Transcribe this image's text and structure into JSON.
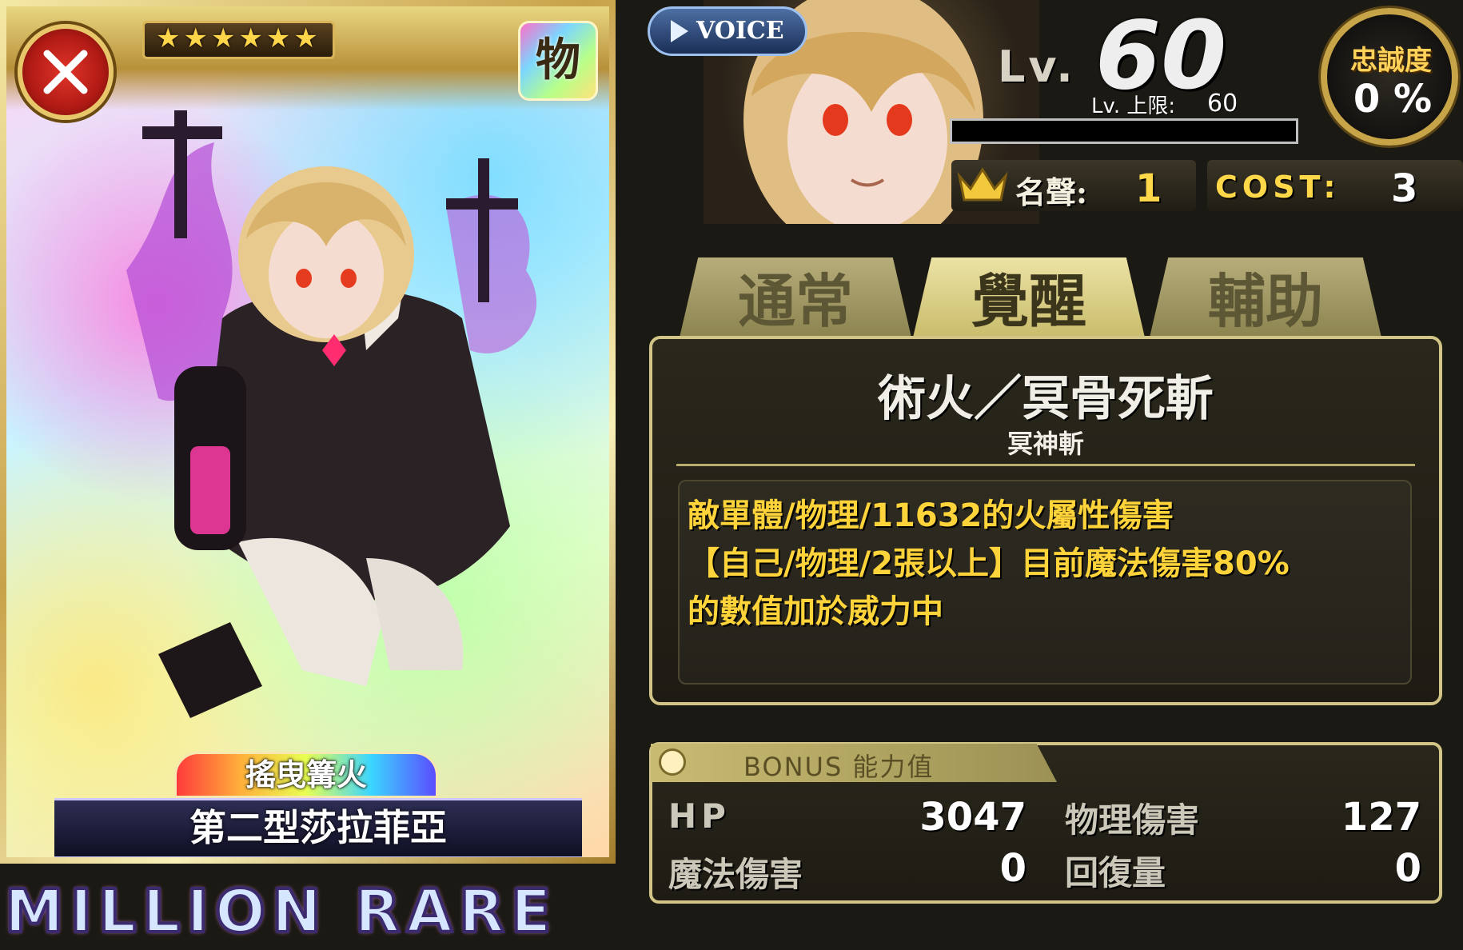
{
  "card": {
    "stars": "★★★★★★",
    "type_badge": "物",
    "subtitle": "搖曳篝火",
    "name": "第二型莎拉菲亞",
    "rarity": "MILLION RARE",
    "emblem_icon": "crossed-swords-icon"
  },
  "voice": {
    "label": "VOICE"
  },
  "level": {
    "label": "Lv.",
    "value": "60",
    "cap_label": "Lv. 上限:",
    "cap_value": "60",
    "exp_fraction": 0
  },
  "loyalty": {
    "label": "忠誠度",
    "value": "0 %"
  },
  "fame": {
    "label": "名聲:",
    "value": "1",
    "icon": "crown-icon"
  },
  "cost": {
    "label": "COST:",
    "value": "3"
  },
  "tabs": [
    {
      "label": "通常",
      "active": false
    },
    {
      "label": "覺醒",
      "active": true
    },
    {
      "label": "輔助",
      "active": false
    }
  ],
  "skill": {
    "name": "術火／冥骨死斬",
    "subname": "冥神斬",
    "description": [
      "敵單體/物理/11632的火屬性傷害",
      "【自己/物理/2張以上】目前魔法傷害80%",
      "的數值加於威力中"
    ]
  },
  "bonus": {
    "title": "BONUS 能力值",
    "stats": {
      "hp": {
        "label": "HP",
        "value": "3047"
      },
      "magic_damage": {
        "label": "魔法傷害",
        "value": "0"
      },
      "physical_damage": {
        "label": "物理傷害",
        "value": "127"
      },
      "recovery": {
        "label": "回復量",
        "value": "0"
      }
    }
  },
  "colors": {
    "accent_gold": "#d2c487",
    "desc_text": "#ffd43a",
    "panel_bg": "#1d1b13"
  }
}
